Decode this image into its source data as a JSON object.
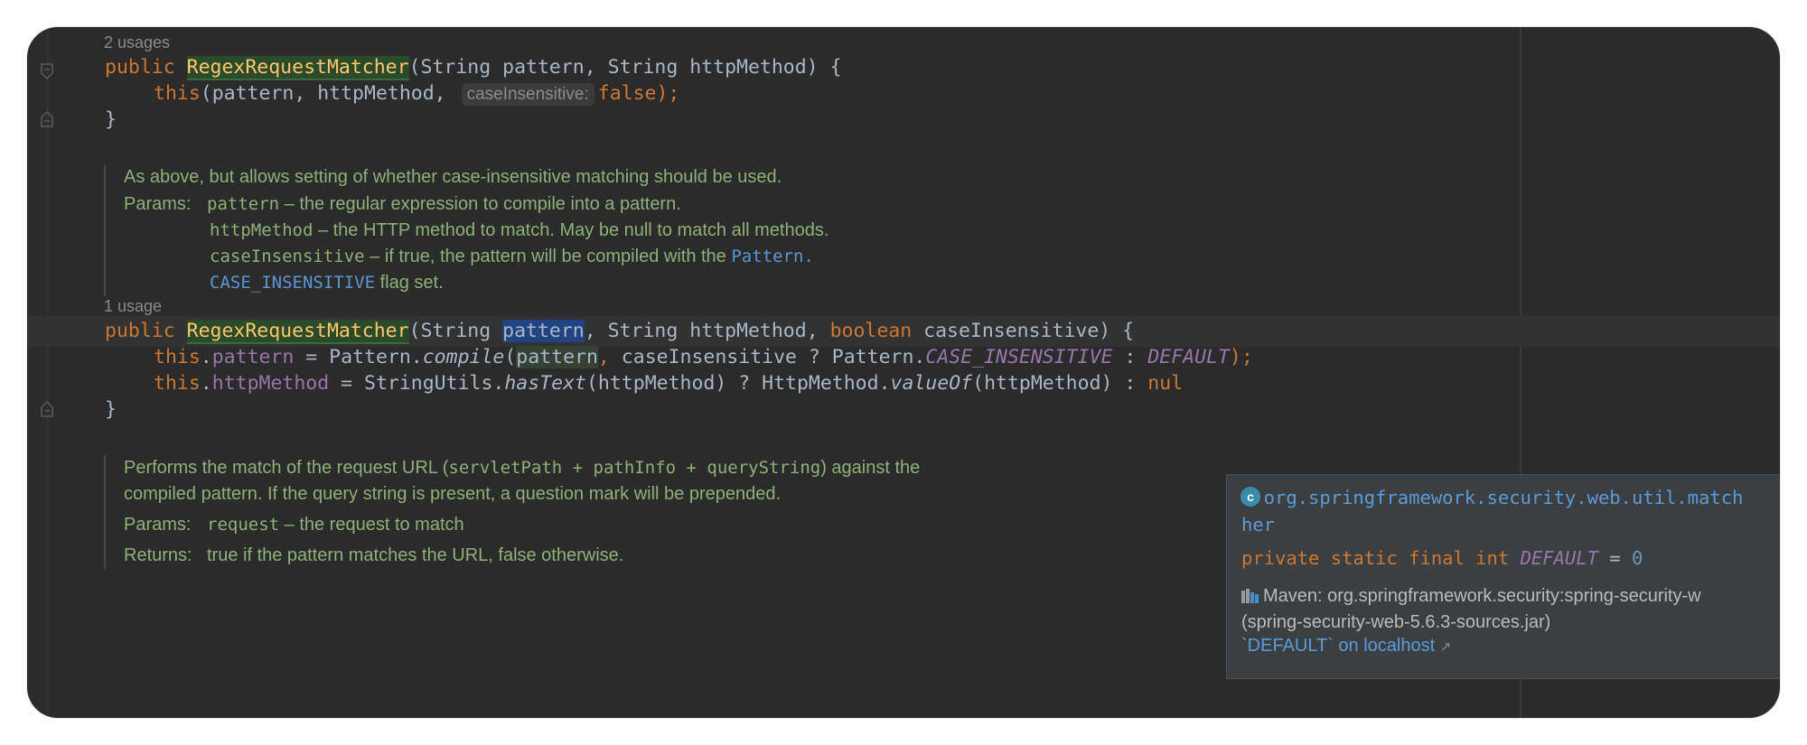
{
  "colors": {
    "keyword": "#cc7832",
    "field": "#9876aa",
    "method_decl": "#ffc66d",
    "doc": "#8fb07a",
    "link": "#5b95d6",
    "plain": "#a9b7c6",
    "background": "#2b2b2b"
  },
  "usages": [
    "2 usages",
    "1 usage"
  ],
  "code": {
    "l1": {
      "kw": "public",
      "name": "RegexRequestMatcher",
      "args": "(String pattern, String httpMethod) {"
    },
    "l2": {
      "kw": "this",
      "a": "(pattern, httpMethod, ",
      "hint": "caseInsensitive:",
      "val": "false",
      "end": ");"
    },
    "close1": "}",
    "l3": {
      "kw": "public",
      "name": "RegexRequestMatcher",
      "a": "(String ",
      "sel": "pattern",
      "b": ", String httpMethod, ",
      "kw2": "boolean",
      "c": " caseInsensitive) {"
    },
    "l4": {
      "kw": "this",
      "dot": ".",
      "field": "pattern",
      "a": " = Pattern.",
      "m": "compile",
      "p": "(",
      "hl": "pattern",
      "comma": ",",
      "b": " caseInsensitive ? Pattern.",
      "const": "CASE_INSENSITIVE",
      "c": " : ",
      "def": "DEFAULT",
      "end": ");"
    },
    "l5": {
      "kw": "this",
      "dot": ".",
      "field": "httpMethod",
      "a": " = StringUtils.",
      "m": "hasText",
      "b": "(httpMethod) ? HttpMethod.",
      "m2": "valueOf",
      "c": "(httpMethod) : ",
      "trail": "nul"
    },
    "close2": "}"
  },
  "doc1": {
    "summary": "As above, but allows setting of whether case-insensitive matching should be used.",
    "params_label": "Params:",
    "p1_name": "pattern",
    "p1_desc": " – the regular expression to compile into a pattern.",
    "p2_name": "httpMethod",
    "p2_desc": " – the HTTP method to match. May be null to match all methods.",
    "p3_name": "caseInsensitive",
    "p3_desc": " – if true, the pattern will be compiled with the ",
    "p3_link1": "Pattern.",
    "p3_link2": "CASE_INSENSITIVE",
    "p3_tail": " flag set."
  },
  "doc2": {
    "s1": "Performs the match of the request URL (",
    "s_code": "servletPath + pathInfo + queryString",
    "s2": ") against the",
    "s3": "compiled pattern. If the query string is present, a question mark will be prepended.",
    "params_label": "Params:",
    "p_name": "request",
    "p_desc": " – the request to match",
    "returns_label": "Returns:",
    "returns_desc": "true if the pattern matches the URL, false otherwise."
  },
  "popup": {
    "class_letter": "c",
    "class_line1": "  org.springframework.security.web.util.match",
    "class_line2": "her",
    "sig_mods": "private static final int ",
    "sig_name": "DEFAULT",
    "sig_eq": " = ",
    "sig_val": "0",
    "maven_line1": "Maven: org.springframework.security:spring-security-w",
    "maven_line2": "(spring-security-web-5.6.3-sources.jar)",
    "ext_link": "`DEFAULT` on localhost",
    "ext_arrow": "↗"
  }
}
